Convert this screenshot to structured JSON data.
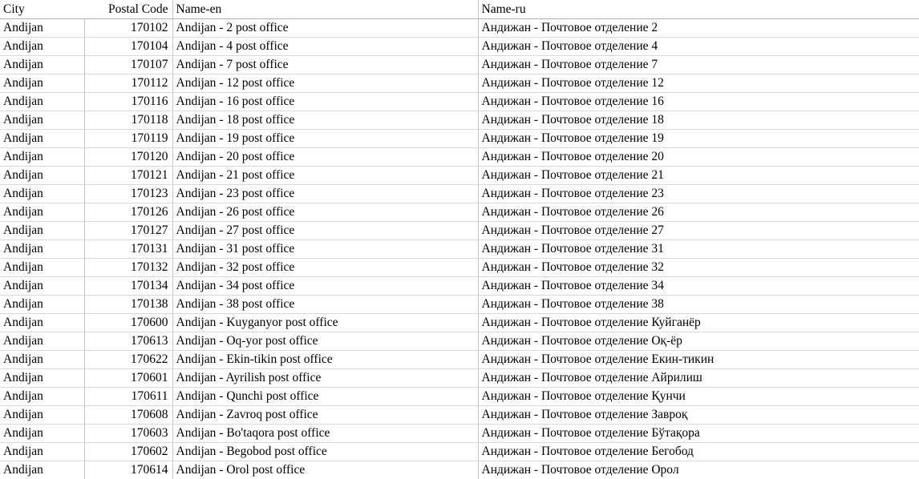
{
  "table": {
    "columns": [
      {
        "key": "city",
        "label": "City",
        "align": "left"
      },
      {
        "key": "postal",
        "label": "Postal Code",
        "align": "right"
      },
      {
        "key": "name_en",
        "label": "Name-en",
        "align": "left"
      },
      {
        "key": "name_ru",
        "label": "Name-ru",
        "align": "left"
      }
    ],
    "rows": [
      {
        "city": "Andijan",
        "postal": "170102",
        "name_en": "Andijan - 2 post office",
        "name_ru": "Андижан - Почтовое отделение 2"
      },
      {
        "city": "Andijan",
        "postal": "170104",
        "name_en": "Andijan - 4 post office",
        "name_ru": "Андижан - Почтовое отделение 4"
      },
      {
        "city": "Andijan",
        "postal": "170107",
        "name_en": "Andijan - 7 post office",
        "name_ru": "Андижан - Почтовое отделение 7"
      },
      {
        "city": "Andijan",
        "postal": "170112",
        "name_en": "Andijan - 12 post office",
        "name_ru": "Андижан - Почтовое отделение 12"
      },
      {
        "city": "Andijan",
        "postal": "170116",
        "name_en": "Andijan - 16 post office",
        "name_ru": "Андижан - Почтовое отделение 16"
      },
      {
        "city": "Andijan",
        "postal": "170118",
        "name_en": "Andijan - 18 post office",
        "name_ru": "Андижан - Почтовое отделение 18"
      },
      {
        "city": "Andijan",
        "postal": "170119",
        "name_en": "Andijan - 19 post office",
        "name_ru": "Андижан - Почтовое отделение 19"
      },
      {
        "city": "Andijan",
        "postal": "170120",
        "name_en": "Andijan - 20 post office",
        "name_ru": "Андижан - Почтовое отделение 20"
      },
      {
        "city": "Andijan",
        "postal": "170121",
        "name_en": "Andijan - 21 post office",
        "name_ru": "Андижан - Почтовое отделение 21"
      },
      {
        "city": "Andijan",
        "postal": "170123",
        "name_en": "Andijan - 23 post office",
        "name_ru": "Андижан - Почтовое отделение 23"
      },
      {
        "city": "Andijan",
        "postal": "170126",
        "name_en": "Andijan - 26 post office",
        "name_ru": "Андижан - Почтовое отделение 26"
      },
      {
        "city": "Andijan",
        "postal": "170127",
        "name_en": "Andijan - 27 post office",
        "name_ru": "Андижан - Почтовое отделение 27"
      },
      {
        "city": "Andijan",
        "postal": "170131",
        "name_en": "Andijan - 31 post office",
        "name_ru": "Андижан - Почтовое отделение 31"
      },
      {
        "city": "Andijan",
        "postal": "170132",
        "name_en": "Andijan - 32 post office",
        "name_ru": "Андижан - Почтовое отделение 32"
      },
      {
        "city": "Andijan",
        "postal": "170134",
        "name_en": "Andijan - 34 post office",
        "name_ru": "Андижан - Почтовое отделение 34"
      },
      {
        "city": "Andijan",
        "postal": "170138",
        "name_en": "Andijan - 38 post office",
        "name_ru": "Андижан - Почтовое отделение 38"
      },
      {
        "city": "Andijan",
        "postal": "170600",
        "name_en": "Andijan - Kuyganyor post office",
        "name_ru": "Андижан - Почтовое отделение Куйганёр"
      },
      {
        "city": "Andijan",
        "postal": "170613",
        "name_en": "Andijan - Oq-yor post office",
        "name_ru": "Андижан - Почтовое отделение Оқ-ёр"
      },
      {
        "city": "Andijan",
        "postal": "170622",
        "name_en": "Andijan - Ekin-tikin post office",
        "name_ru": "Андижан - Почтовое отделение Екин-тикин"
      },
      {
        "city": "Andijan",
        "postal": "170601",
        "name_en": "Andijan - Ayrilish post office",
        "name_ru": "Андижан - Почтовое отделение Айрилиш"
      },
      {
        "city": "Andijan",
        "postal": "170611",
        "name_en": "Andijan - Qunchi post office",
        "name_ru": "Андижан - Почтовое отделение Қунчи"
      },
      {
        "city": "Andijan",
        "postal": "170608",
        "name_en": "Andijan - Zavroq post office",
        "name_ru": "Андижан - Почтовое отделение Заврoқ"
      },
      {
        "city": "Andijan",
        "postal": "170603",
        "name_en": "Andijan - Bo'taqora post office",
        "name_ru": "Андижан - Почтовое отделение Бўтақора"
      },
      {
        "city": "Andijan",
        "postal": "170602",
        "name_en": "Andijan - Begobod post office",
        "name_ru": "Андижан - Почтовое отделение Бегобод"
      },
      {
        "city": "Andijan",
        "postal": "170614",
        "name_en": "Andijan - Orol post office",
        "name_ru": "Андижан - Почтовое отделение Орол"
      }
    ]
  },
  "style": {
    "grid_line_color": "#d9d9d9",
    "column_line_color": "#c8c8c8",
    "header_rule_color": "#b4b4b4",
    "text_color": "#000000",
    "background": "#ffffff"
  }
}
